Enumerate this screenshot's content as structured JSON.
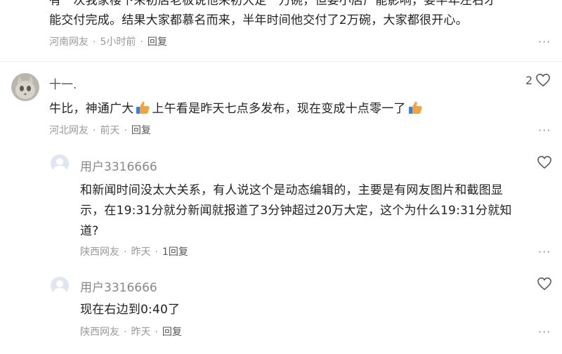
{
  "top_comment": {
    "text_line1": "有一次我家楼下来初店老板说他来初大定一万碗，但要小店产能影响，要半年左右才",
    "text_line2": "能交付完成。结果大家都慕名而来，半年时间他交付了2万碗，大家都很开心。",
    "location": "河南网友",
    "time": "5小时前",
    "reply_label": "回复",
    "more": "···"
  },
  "comment": {
    "username": "十一.",
    "like_count": "2",
    "text_part1": "牛比，神通广大",
    "text_part2": "上午看是昨天七点多发布，现在变成十点零一了",
    "location": "河北网友",
    "time": "前天",
    "reply_label": "回复",
    "more": "···"
  },
  "replies": [
    {
      "username": "用户3316666",
      "text_line1": "和新闻时间没太大关系，有人说这个是动态编辑的，主要是有网友图片和截图显",
      "text_line2": "示，在19:31分就分新闻就报道了3分钟超过20万大定，这个为什么19:31分就知",
      "text_line3": "道?",
      "location": "陕西网友",
      "time": "昨天",
      "reply_label": "1回复",
      "more": "···"
    },
    {
      "username": "用户3316666",
      "text_line1": "现在右边到0:40了",
      "location": "陕西网友",
      "time": "昨天",
      "reply_label": "回复",
      "more": "···"
    }
  ],
  "colors": {
    "text": "#222222",
    "meta": "#999999",
    "thumb": "#f2a33a",
    "avatar_default": "#dfe6f2"
  },
  "icons": [
    "heart-outline-icon",
    "thumbs-up-emoji-icon",
    "default-user-avatar-icon",
    "cat-avatar-icon"
  ]
}
